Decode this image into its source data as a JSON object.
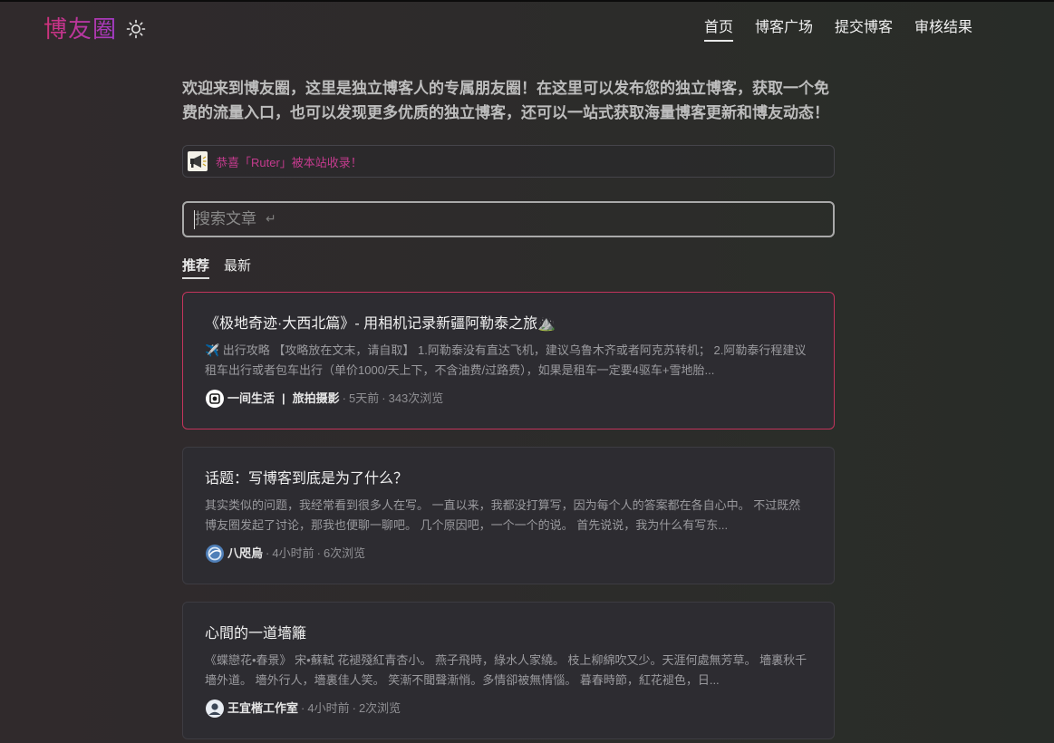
{
  "header": {
    "logo": "博友圈",
    "theme_toggle_icon": "sun-icon",
    "nav": [
      {
        "label": "首页",
        "active": true
      },
      {
        "label": "博客广场",
        "active": false
      },
      {
        "label": "提交博客",
        "active": false
      },
      {
        "label": "审核结果",
        "active": false
      }
    ]
  },
  "intro": "欢迎来到博友圈，这里是独立博客人的专属朋友圈！在这里可以发布您的独立博客，获取一个免费的流量入口，也可以发现更多优质的独立博客，还可以一站式获取海量博客更新和博友动态！",
  "notice": {
    "icon": "megaphone-icon",
    "text": "恭喜「Ruter」被本站收录！"
  },
  "search": {
    "placeholder": "搜索文章",
    "value": "",
    "return_glyph": "↵"
  },
  "tabs": [
    {
      "label": "推荐",
      "active": true
    },
    {
      "label": "最新",
      "active": false
    }
  ],
  "articles": [
    {
      "title": "《极地奇迹·大西北篇》- 用相机记录新疆阿勒泰之旅⛰️",
      "excerpt": "✈️ 出行攻略 【攻略放在文末，请自取】 1.阿勒泰没有直达飞机，建议乌鲁木齐或者阿克苏转机； 2.阿勒泰行程建议租车出行或者包车出行（单价1000/天上下，不含油费/过路费），如果是租车一定要4驱车+雪地胎...",
      "author": "一间生活",
      "category": "旅拍摄影",
      "time": "5天前",
      "views": "343次浏览",
      "highlight": true
    },
    {
      "title": "话题：写博客到底是为了什么？",
      "excerpt": "其实类似的问题，我经常看到很多人在写。 一直以来，我都没打算写，因为每个人的答案都在各自心中。 不过既然博友圈发起了讨论，那我也便聊一聊吧。 几个原因吧，一个一个的说。 首先说说，我为什么有写东...",
      "author": "八咫烏",
      "category": "",
      "time": "4小时前",
      "views": "6次浏览",
      "highlight": false
    },
    {
      "title": "心間的一道墻籬",
      "excerpt": "《蝶戀花•春景》 宋•蘇軾 花褪殘紅青杏小。 燕子飛時，綠水人家繞。 枝上柳綿吹又少。天涯何處無芳草。 墻裏秋千墻外道。 墻外行人，墻裏佳人笑。 笑漸不聞聲漸悄。多情卻被無情惱。 暮春時節，紅花褪色，日...",
      "author": "王宜楷工作室",
      "category": "",
      "time": "4小时前",
      "views": "2次浏览",
      "highlight": false
    }
  ],
  "colors": {
    "accent_pink": "#c43b8e",
    "highlight_border": "#c2345c"
  }
}
